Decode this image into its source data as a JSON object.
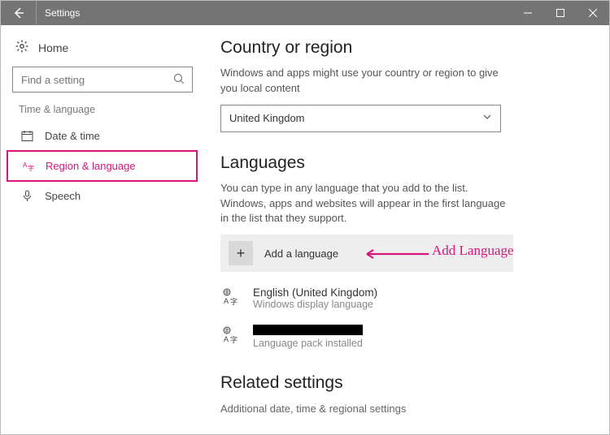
{
  "titlebar": {
    "title": "Settings"
  },
  "sidebar": {
    "home_label": "Home",
    "search_placeholder": "Find a setting",
    "section_label": "Time & language",
    "items": [
      {
        "label": "Date & time"
      },
      {
        "label": "Region & language"
      },
      {
        "label": "Speech"
      }
    ]
  },
  "main": {
    "country": {
      "heading": "Country or region",
      "desc": "Windows and apps might use your country or region to give you local content",
      "selected": "United Kingdom"
    },
    "languages": {
      "heading": "Languages",
      "desc": "You can type in any language that you add to the list. Windows, apps and websites will appear in the first language in the list that they support.",
      "add_label": "Add a language",
      "annotation": "Add Language",
      "items": [
        {
          "name": "English (United Kingdom)",
          "sub": "Windows display language"
        },
        {
          "name": "",
          "sub": "Language pack installed",
          "redacted": true
        }
      ]
    },
    "related": {
      "heading": "Related settings",
      "link": "Additional date, time & regional settings"
    }
  }
}
